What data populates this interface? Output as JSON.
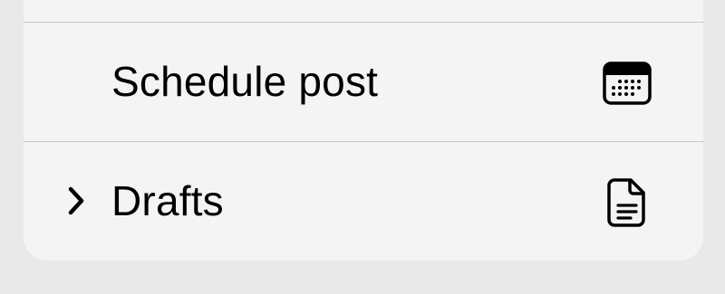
{
  "menu": {
    "items": [
      {
        "label": "Schedule post",
        "icon": "calendar-icon",
        "disclosure": false
      },
      {
        "label": "Drafts",
        "icon": "document-icon",
        "disclosure": true
      }
    ]
  },
  "colors": {
    "page_background": "#e9e9e9",
    "card_background": "#f4f4f4",
    "divider": "#c6c6c8",
    "text": "#000000"
  }
}
